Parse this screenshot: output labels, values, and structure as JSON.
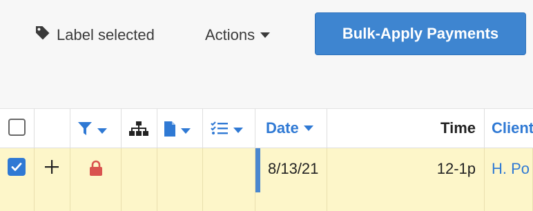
{
  "toolbar": {
    "label_selected": "Label selected",
    "actions": "Actions",
    "bulk_apply": "Bulk-Apply Payments"
  },
  "table": {
    "headers": {
      "date": "Date",
      "time": "Time",
      "client": "Client"
    },
    "header_icons": [
      "checkbox",
      "filter-icon",
      "hierarchy-icon",
      "document-icon",
      "checklist-icon"
    ],
    "rows": [
      {
        "selected": true,
        "locked": true,
        "date": "8/13/21",
        "time": "12-1p",
        "client": "H. Po"
      }
    ]
  },
  "colors": {
    "accent": "#2f79d4",
    "button": "#3e85d0",
    "row_highlight": "#fdf6c9",
    "lock": "#d9534f",
    "date_bar": "#4a87cf"
  }
}
